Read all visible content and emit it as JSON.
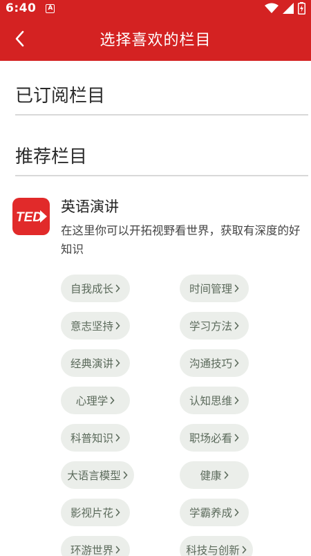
{
  "status_bar": {
    "time": "6:40",
    "app_indicator": "A",
    "icons": [
      "wifi-icon",
      "cell-signal-icon",
      "battery-icon"
    ]
  },
  "header": {
    "title": "选择喜欢的栏目",
    "back_icon": "chevron-left-icon"
  },
  "sections": {
    "subscribed": "已订阅栏目",
    "recommended": "推荐栏目"
  },
  "channel": {
    "logo_text": "TED",
    "title": "英语演讲",
    "description": "在这里你可以开拓视野看世界，获取有深度的好知识"
  },
  "tags": [
    {
      "label": "自我成长"
    },
    {
      "label": "时间管理"
    },
    {
      "label": "意志坚持"
    },
    {
      "label": "学习方法"
    },
    {
      "label": "经典演讲"
    },
    {
      "label": "沟通技巧"
    },
    {
      "label": "心理学"
    },
    {
      "label": "认知思维"
    },
    {
      "label": "科普知识"
    },
    {
      "label": "职场必看"
    },
    {
      "label": "大语言模型"
    },
    {
      "label": "健康"
    },
    {
      "label": "影视片花"
    },
    {
      "label": "学霸养成"
    },
    {
      "label": "环游世界"
    },
    {
      "label": "科技与创新"
    }
  ],
  "colors": {
    "brand_red": "#d42222",
    "tag_bg": "#ebeeea",
    "tag_text": "#5c6b5c"
  }
}
